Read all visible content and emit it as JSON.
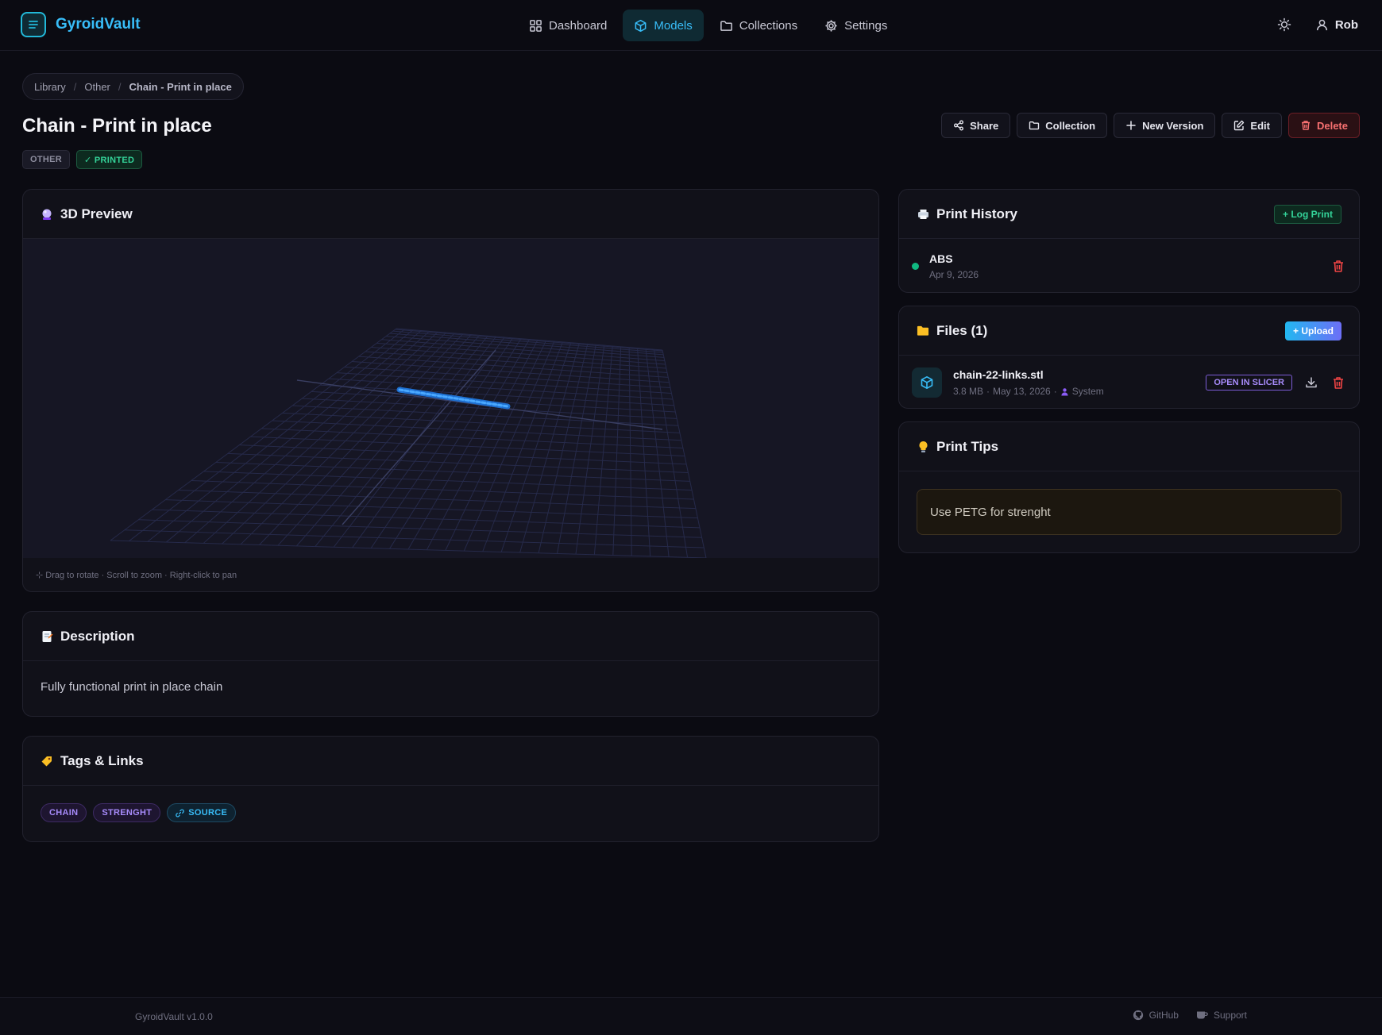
{
  "app": {
    "name": "GyroidVault",
    "logo_icon": "list-icon"
  },
  "nav": {
    "items": [
      {
        "label": "Dashboard",
        "icon": "grid-icon"
      },
      {
        "label": "Models",
        "icon": "cube-icon",
        "active": true
      },
      {
        "label": "Collections",
        "icon": "folder-icon"
      },
      {
        "label": "Settings",
        "icon": "gear-icon"
      }
    ]
  },
  "user": {
    "name": "Rob",
    "theme_icon": "sun-icon"
  },
  "breadcrumb": {
    "items": [
      "Library",
      "Other",
      "Chain - Print in place"
    ],
    "separator": "/"
  },
  "model": {
    "title": "Chain - Print in place",
    "category_badge": "OTHER",
    "status_badge": "✓ PRINTED"
  },
  "actions": {
    "share": "Share",
    "collection": "Collection",
    "new_version": "New Version",
    "edit": "Edit",
    "delete": "Delete"
  },
  "preview": {
    "title": "3D Preview",
    "hint": "⊹ Drag to rotate · Scroll to zoom · Right-click to pan"
  },
  "description": {
    "title": "Description",
    "text": "Fully functional print in place chain"
  },
  "tags_links": {
    "title": "Tags & Links",
    "tags": [
      "CHAIN",
      "STRENGHT"
    ],
    "source_label": "SOURCE"
  },
  "print_history": {
    "title": "Print History",
    "log_button": "+ Log Print",
    "entries": [
      {
        "material": "ABS",
        "date": "Apr 9, 2026",
        "status_color": "#10b981"
      }
    ]
  },
  "files": {
    "title": "Files (1)",
    "upload_button": "+ Upload",
    "items": [
      {
        "name": "chain-22-links.stl",
        "size": "3.8 MB",
        "date": "May 13, 2026",
        "uploader": "System",
        "slicer_button": "OPEN IN SLICER"
      }
    ]
  },
  "print_tips": {
    "title": "Print Tips",
    "text": "Use PETG for strenght"
  },
  "footer": {
    "version": "GyroidVault v1.0.0",
    "github": "GitHub",
    "support": "Support"
  },
  "colors": {
    "accent": "#38bdf8",
    "danger": "#f87171",
    "success": "#34d399",
    "purple": "#a78bfa",
    "background": "#0b0b12"
  }
}
